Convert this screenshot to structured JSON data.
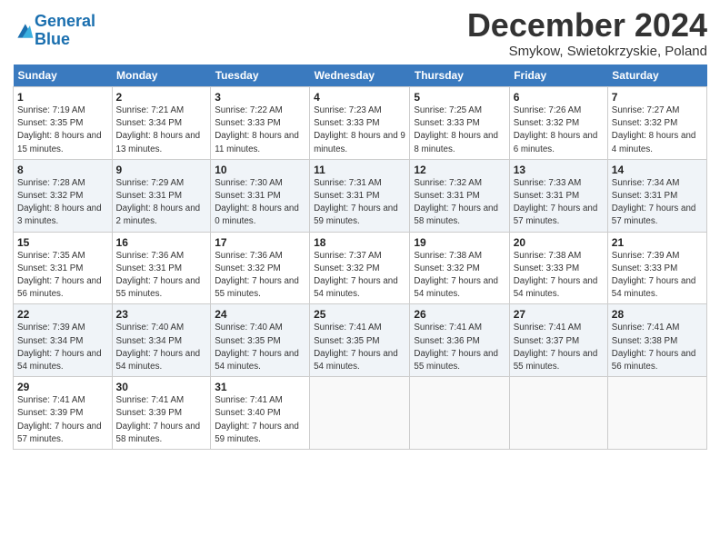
{
  "header": {
    "logo_line1": "General",
    "logo_line2": "Blue",
    "month": "December 2024",
    "location": "Smykow, Swietokrzyskie, Poland"
  },
  "days_of_week": [
    "Sunday",
    "Monday",
    "Tuesday",
    "Wednesday",
    "Thursday",
    "Friday",
    "Saturday"
  ],
  "weeks": [
    [
      {
        "day": "1",
        "sunrise": "7:19 AM",
        "sunset": "3:35 PM",
        "daylight": "8 hours and 15 minutes."
      },
      {
        "day": "2",
        "sunrise": "7:21 AM",
        "sunset": "3:34 PM",
        "daylight": "8 hours and 13 minutes."
      },
      {
        "day": "3",
        "sunrise": "7:22 AM",
        "sunset": "3:33 PM",
        "daylight": "8 hours and 11 minutes."
      },
      {
        "day": "4",
        "sunrise": "7:23 AM",
        "sunset": "3:33 PM",
        "daylight": "8 hours and 9 minutes."
      },
      {
        "day": "5",
        "sunrise": "7:25 AM",
        "sunset": "3:33 PM",
        "daylight": "8 hours and 8 minutes."
      },
      {
        "day": "6",
        "sunrise": "7:26 AM",
        "sunset": "3:32 PM",
        "daylight": "8 hours and 6 minutes."
      },
      {
        "day": "7",
        "sunrise": "7:27 AM",
        "sunset": "3:32 PM",
        "daylight": "8 hours and 4 minutes."
      }
    ],
    [
      {
        "day": "8",
        "sunrise": "7:28 AM",
        "sunset": "3:32 PM",
        "daylight": "8 hours and 3 minutes."
      },
      {
        "day": "9",
        "sunrise": "7:29 AM",
        "sunset": "3:31 PM",
        "daylight": "8 hours and 2 minutes."
      },
      {
        "day": "10",
        "sunrise": "7:30 AM",
        "sunset": "3:31 PM",
        "daylight": "8 hours and 0 minutes."
      },
      {
        "day": "11",
        "sunrise": "7:31 AM",
        "sunset": "3:31 PM",
        "daylight": "7 hours and 59 minutes."
      },
      {
        "day": "12",
        "sunrise": "7:32 AM",
        "sunset": "3:31 PM",
        "daylight": "7 hours and 58 minutes."
      },
      {
        "day": "13",
        "sunrise": "7:33 AM",
        "sunset": "3:31 PM",
        "daylight": "7 hours and 57 minutes."
      },
      {
        "day": "14",
        "sunrise": "7:34 AM",
        "sunset": "3:31 PM",
        "daylight": "7 hours and 57 minutes."
      }
    ],
    [
      {
        "day": "15",
        "sunrise": "7:35 AM",
        "sunset": "3:31 PM",
        "daylight": "7 hours and 56 minutes."
      },
      {
        "day": "16",
        "sunrise": "7:36 AM",
        "sunset": "3:31 PM",
        "daylight": "7 hours and 55 minutes."
      },
      {
        "day": "17",
        "sunrise": "7:36 AM",
        "sunset": "3:32 PM",
        "daylight": "7 hours and 55 minutes."
      },
      {
        "day": "18",
        "sunrise": "7:37 AM",
        "sunset": "3:32 PM",
        "daylight": "7 hours and 54 minutes."
      },
      {
        "day": "19",
        "sunrise": "7:38 AM",
        "sunset": "3:32 PM",
        "daylight": "7 hours and 54 minutes."
      },
      {
        "day": "20",
        "sunrise": "7:38 AM",
        "sunset": "3:33 PM",
        "daylight": "7 hours and 54 minutes."
      },
      {
        "day": "21",
        "sunrise": "7:39 AM",
        "sunset": "3:33 PM",
        "daylight": "7 hours and 54 minutes."
      }
    ],
    [
      {
        "day": "22",
        "sunrise": "7:39 AM",
        "sunset": "3:34 PM",
        "daylight": "7 hours and 54 minutes."
      },
      {
        "day": "23",
        "sunrise": "7:40 AM",
        "sunset": "3:34 PM",
        "daylight": "7 hours and 54 minutes."
      },
      {
        "day": "24",
        "sunrise": "7:40 AM",
        "sunset": "3:35 PM",
        "daylight": "7 hours and 54 minutes."
      },
      {
        "day": "25",
        "sunrise": "7:41 AM",
        "sunset": "3:35 PM",
        "daylight": "7 hours and 54 minutes."
      },
      {
        "day": "26",
        "sunrise": "7:41 AM",
        "sunset": "3:36 PM",
        "daylight": "7 hours and 55 minutes."
      },
      {
        "day": "27",
        "sunrise": "7:41 AM",
        "sunset": "3:37 PM",
        "daylight": "7 hours and 55 minutes."
      },
      {
        "day": "28",
        "sunrise": "7:41 AM",
        "sunset": "3:38 PM",
        "daylight": "7 hours and 56 minutes."
      }
    ],
    [
      {
        "day": "29",
        "sunrise": "7:41 AM",
        "sunset": "3:39 PM",
        "daylight": "7 hours and 57 minutes."
      },
      {
        "day": "30",
        "sunrise": "7:41 AM",
        "sunset": "3:39 PM",
        "daylight": "7 hours and 58 minutes."
      },
      {
        "day": "31",
        "sunrise": "7:41 AM",
        "sunset": "3:40 PM",
        "daylight": "7 hours and 59 minutes."
      },
      null,
      null,
      null,
      null
    ]
  ]
}
